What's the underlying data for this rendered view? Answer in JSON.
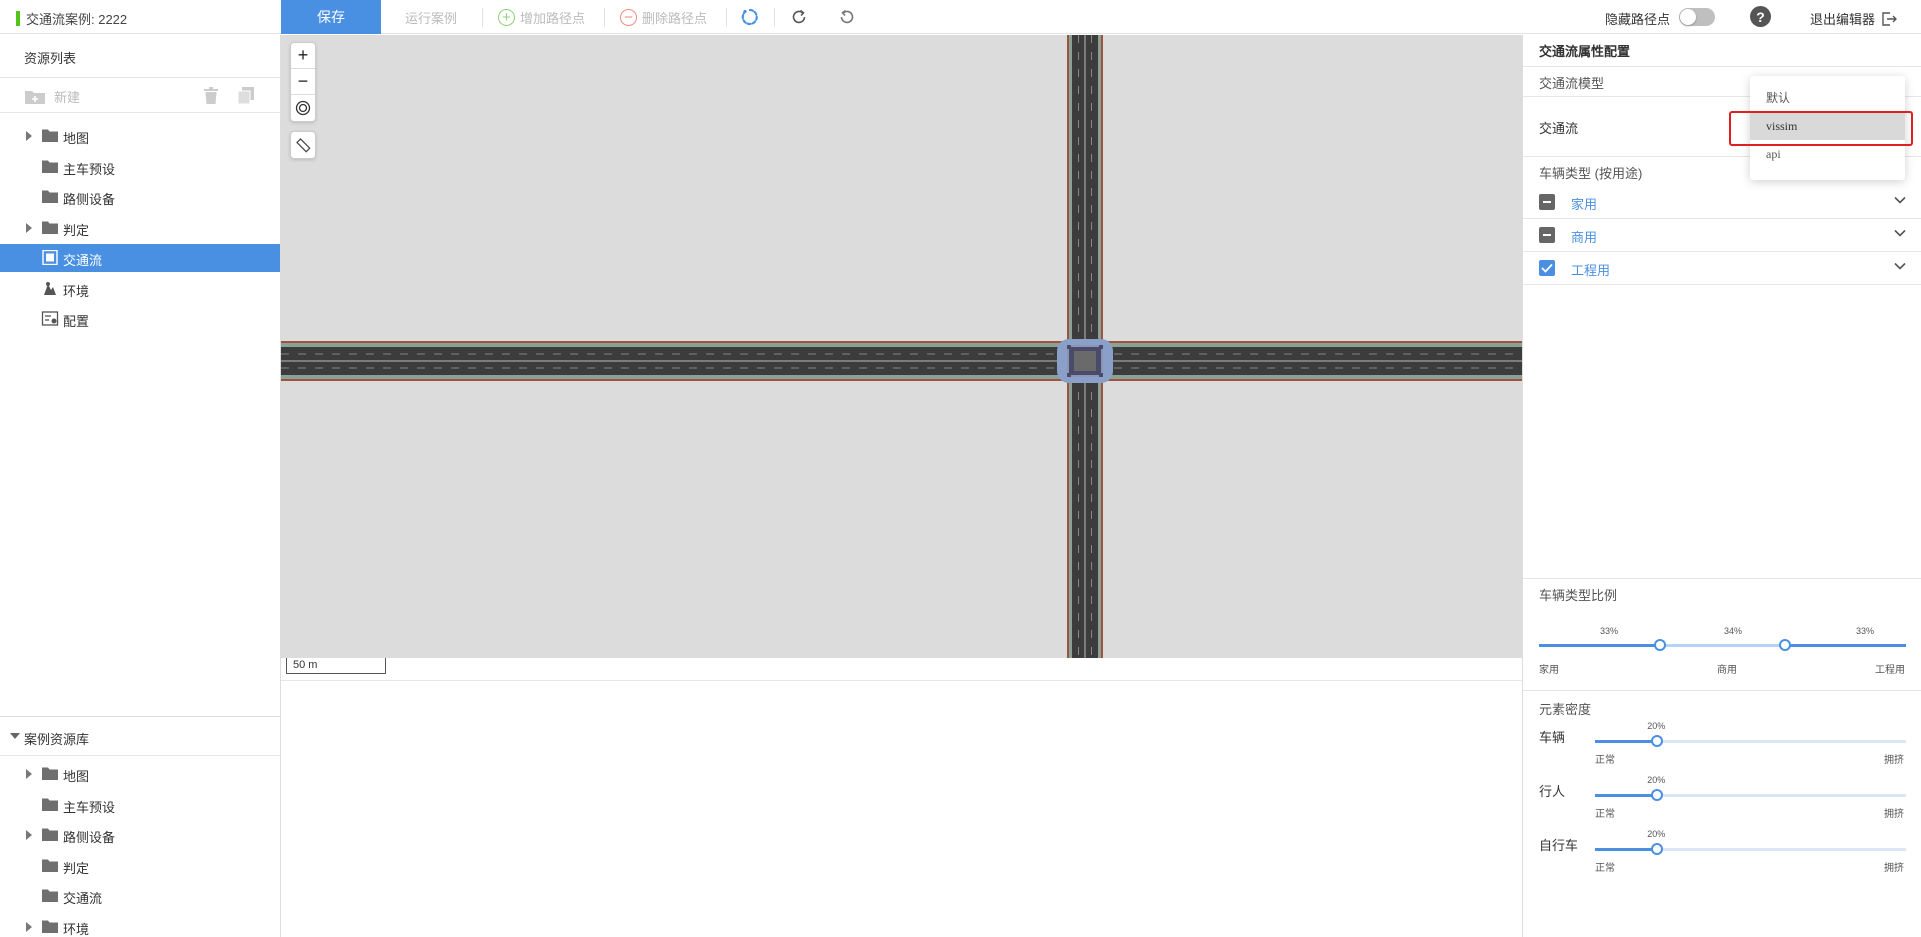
{
  "toolbar": {
    "case_title": "交通流案例: 2222",
    "save": "保存",
    "run_case": "运行案例",
    "add_waypoint": "增加路径点",
    "delete_waypoint": "删除路径点",
    "hide_waypoint": "隐藏路径点",
    "exit_editor": "退出编辑器",
    "help": "?"
  },
  "left": {
    "resource_list_title": "资源列表",
    "new_label": "新建",
    "tree": [
      {
        "label": "地图",
        "icon": "folder-icon",
        "expandable": true
      },
      {
        "label": "主车预设",
        "icon": "folder-icon",
        "expandable": false
      },
      {
        "label": "路侧设备",
        "icon": "folder-icon",
        "expandable": false
      },
      {
        "label": "判定",
        "icon": "folder-icon",
        "expandable": true
      },
      {
        "label": "交通流",
        "icon": "traffic-flow-icon",
        "expandable": false,
        "active": true
      },
      {
        "label": "环境",
        "icon": "environment-icon",
        "expandable": false
      },
      {
        "label": "配置",
        "icon": "config-icon",
        "expandable": false
      }
    ],
    "library_title": "案例资源库",
    "library": [
      {
        "label": "地图",
        "expandable": true
      },
      {
        "label": "主车预设",
        "expandable": false
      },
      {
        "label": "路侧设备",
        "expandable": true
      },
      {
        "label": "判定",
        "expandable": false
      },
      {
        "label": "交通流",
        "expandable": false
      },
      {
        "label": "环境",
        "expandable": true
      }
    ]
  },
  "map": {
    "zoom_in": "+",
    "zoom_out": "−",
    "scale": "50 m"
  },
  "right": {
    "title": "交通流属性配置",
    "flow_model_section": "交通流模型",
    "flow_label": "交通流",
    "vehicle_type_section": "车辆类型 (按用途)",
    "vehicle_types": [
      {
        "label": "家用",
        "state": "indeterminate"
      },
      {
        "label": "商用",
        "state": "indeterminate"
      },
      {
        "label": "工程用",
        "state": "checked"
      }
    ],
    "ratio_section": "车辆类型比例",
    "ratio": {
      "values": [
        "33%",
        "34%",
        "33%"
      ],
      "labels": [
        "家用",
        "商用",
        "工程用"
      ],
      "split_1": 0.33,
      "split_2": 0.67
    },
    "density_section": "元素密度",
    "density": [
      {
        "label": "车辆",
        "value": "20%",
        "fraction": 0.2,
        "min": "正常",
        "max": "拥挤"
      },
      {
        "label": "行人",
        "value": "20%",
        "fraction": 0.2,
        "min": "正常",
        "max": "拥挤"
      },
      {
        "label": "自行车",
        "value": "20%",
        "fraction": 0.2,
        "min": "正常",
        "max": "拥挤"
      }
    ]
  },
  "dropdown": {
    "options": [
      "默认",
      "vissim",
      "api"
    ],
    "hovered": "vissim"
  },
  "colors": {
    "accent": "#4a90e2",
    "highlight": "#e02020"
  }
}
